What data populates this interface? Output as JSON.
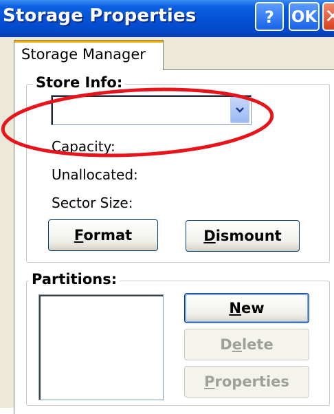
{
  "window": {
    "title": "Storage Properties",
    "title_buttons": {
      "help": "?",
      "ok": "OK",
      "close": "✕"
    }
  },
  "tab": {
    "label": "Storage Manager"
  },
  "store_info": {
    "legend": "Store Info:",
    "store_select_value": "",
    "capacity_label": "Capacity:",
    "unallocated_label": "Unallocated:",
    "sector_size_label": "Sector Size:",
    "format_button": {
      "mnemonic": "F",
      "rest": "ormat"
    },
    "dismount_button": {
      "mnemonic": "D",
      "rest": "ismount"
    }
  },
  "partitions": {
    "legend": "Partitions:",
    "new_button": {
      "mnemonic": "N",
      "rest": "ew",
      "enabled": true
    },
    "delete_button": {
      "pre": "D",
      "mnemonic": "e",
      "rest": "lete",
      "enabled": false
    },
    "properties_button": {
      "mnemonic": "P",
      "rest": "roperties",
      "enabled": false
    }
  },
  "annotation": {
    "color": "#e8141c",
    "shape": "ellipse-highlight"
  },
  "colors": {
    "titlebar": "#0551d6",
    "window_bg": "#ece9d8",
    "highlight": "#e8141c"
  }
}
